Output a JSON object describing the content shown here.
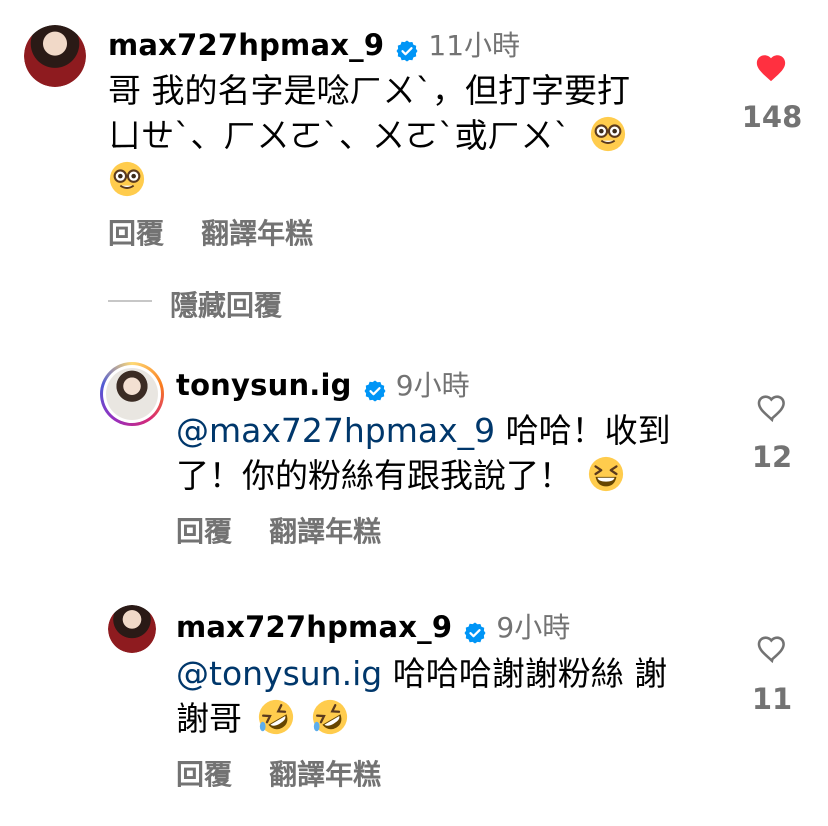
{
  "comments": [
    {
      "username": "max727hpmax_9",
      "time": "11小時",
      "text_line1": "哥 我的名字是唸ㄏㄨˋ，但打字要打",
      "text_line2": "ㄩㄝˋ、ㄏㄨㄛˋ、ㄨㄛˋ或ㄏㄨˋ",
      "likes": "148",
      "liked": true,
      "reply_label": "回覆",
      "translate_label": "翻譯年糕"
    },
    {
      "username": "tonysun.ig",
      "time": "9小時",
      "mention": "@max727hpmax_9",
      "text_line1": " 哈哈！收到",
      "text_line2": "了！你的粉絲有跟我說了！",
      "likes": "12",
      "reply_label": "回覆",
      "translate_label": "翻譯年糕"
    },
    {
      "username": "max727hpmax_9",
      "time": "9小時",
      "mention": "@tonysun.ig",
      "text_line1": " 哈哈哈謝謝粉絲 謝",
      "text_line2": "謝哥",
      "likes": "11",
      "reply_label": "回覆",
      "translate_label": "翻譯年糕"
    }
  ],
  "hide_replies_label": "隱藏回覆",
  "colors": {
    "heart_liked": "#ff3040",
    "verified": "#0095f6",
    "mention": "#00376b",
    "muted": "#737373"
  }
}
